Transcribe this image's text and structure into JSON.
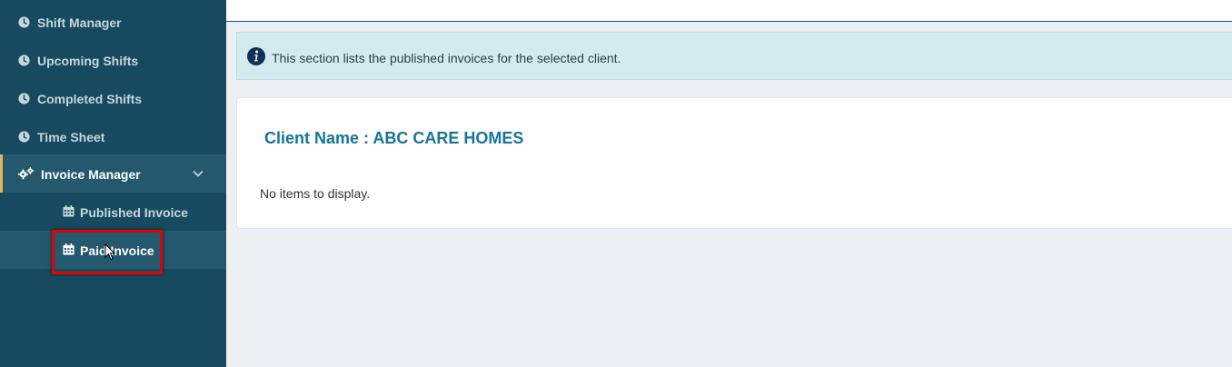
{
  "sidebar": {
    "items": [
      {
        "label": "Shift Manager",
        "icon": "clock-icon"
      },
      {
        "label": "Upcoming Shifts",
        "icon": "clock-icon"
      },
      {
        "label": "Completed Shifts",
        "icon": "clock-icon"
      },
      {
        "label": "Time Sheet",
        "icon": "clock-icon"
      }
    ],
    "active_group": {
      "label": "Invoice Manager",
      "icon": "gears-icon",
      "expand_icon": "chevron-down-icon",
      "expanded": true
    },
    "sub_items": [
      {
        "label": "Published Invoice",
        "icon": "calendar-icon",
        "selected": false
      },
      {
        "label": "Paid Invoice",
        "icon": "calendar-icon",
        "selected": true
      }
    ],
    "accent_color": "#e0b85a",
    "highlight_color": "#e60000"
  },
  "alert": {
    "icon": "info-icon",
    "message": "This section lists the published invoices for the selected client."
  },
  "card": {
    "client_label": "Client Name : ABC CARE HOMES",
    "empty_message": "No items to display."
  }
}
